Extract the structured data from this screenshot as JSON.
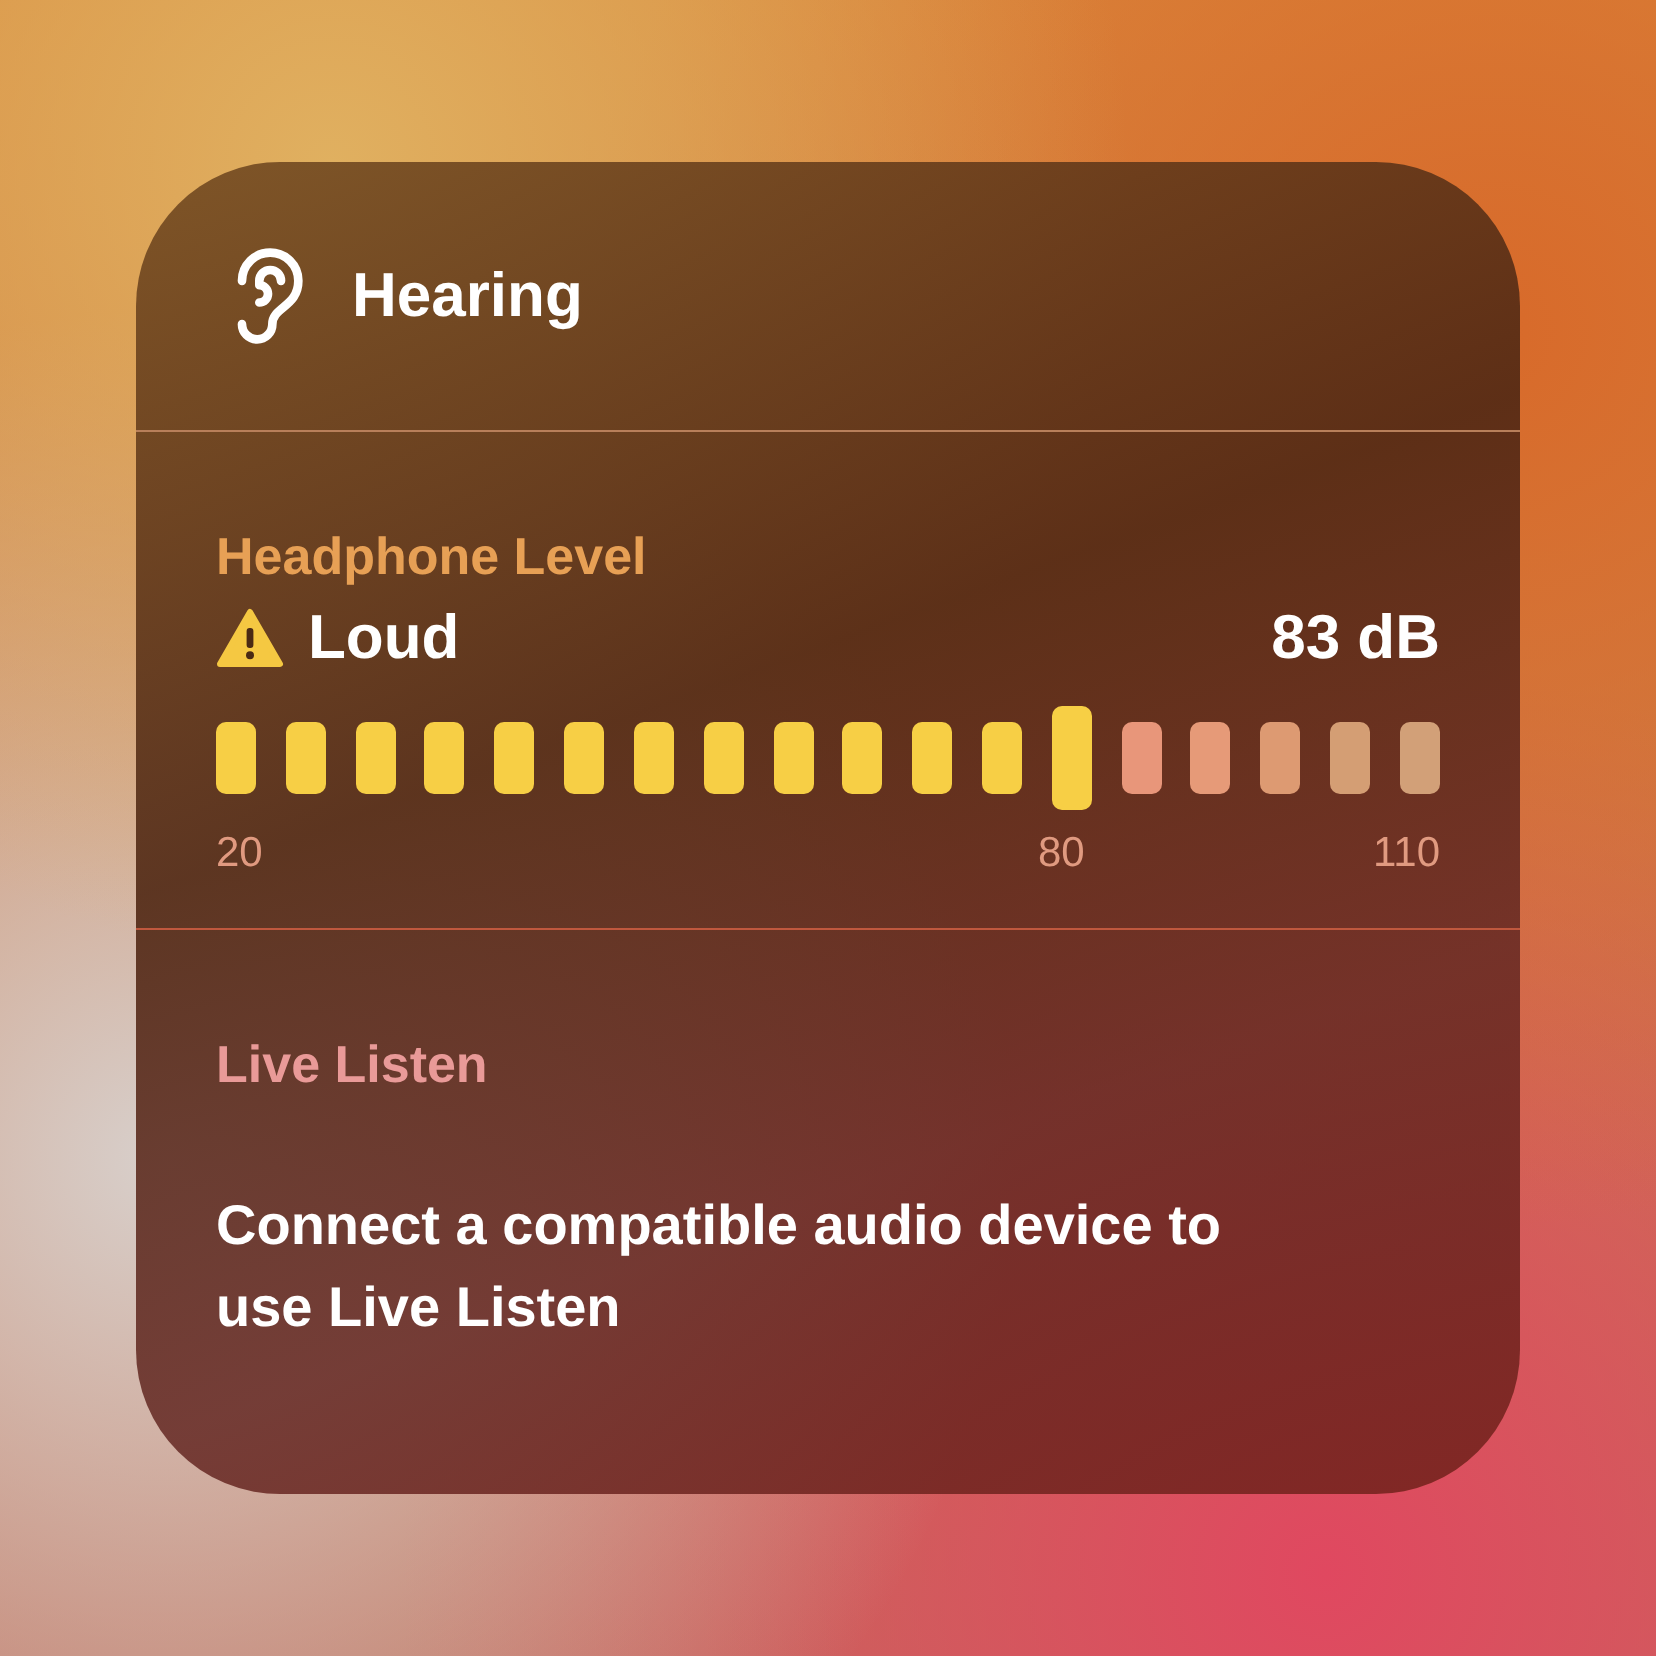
{
  "module": {
    "title": "Hearing"
  },
  "headphone_level": {
    "heading": "Headphone Level",
    "status": "Loud",
    "warning": true,
    "reading": "83 dB",
    "level": 0.7,
    "ticks": [
      {
        "label": "20"
      },
      {
        "label": "80"
      },
      {
        "label": "110"
      }
    ]
  },
  "live_listen": {
    "heading": "Live Listen",
    "message": "Connect a compatible audio device to use Live Listen"
  }
}
